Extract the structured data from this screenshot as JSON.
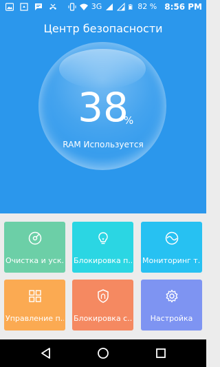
{
  "status_bar": {
    "left_icons": [
      "image-icon",
      "screenshot-icon",
      "message-icon",
      "missed-call-icon"
    ],
    "right_icons": [
      "vibrate-icon",
      "wifi-icon",
      "signal-icon",
      "signal-2-icon",
      "battery-icon"
    ],
    "network": "3G",
    "battery": "82 %",
    "time": "8:56 PM"
  },
  "header": {
    "title": "Центр безопасности",
    "ram_percent": "38",
    "percent_sign": "%",
    "ram_label": "RAM Используется"
  },
  "tiles": [
    {
      "label": "Очистка и уск...",
      "icon": "broom-icon",
      "color": "#6ccfa7"
    },
    {
      "label": "Блокировка п...",
      "icon": "lightbulb-icon",
      "color": "#2bd6e3"
    },
    {
      "label": "Мониторинг т...",
      "icon": "traffic-monitor-icon",
      "color": "#27c1f2"
    },
    {
      "label": "Управление п...",
      "icon": "apps-grid-icon",
      "color": "#fbaa52"
    },
    {
      "label": "Блокировка с...",
      "icon": "shield-icon",
      "color": "#f58961"
    },
    {
      "label": "Настройка",
      "icon": "gear-icon",
      "color": "#7e94f2"
    }
  ],
  "nav_bar": {
    "back": "back-icon",
    "home": "home-icon",
    "recents": "recents-icon"
  },
  "colors": {
    "header_bg": "#2b97ec",
    "page_bg": "#ececec",
    "nav_bg": "#000000"
  }
}
